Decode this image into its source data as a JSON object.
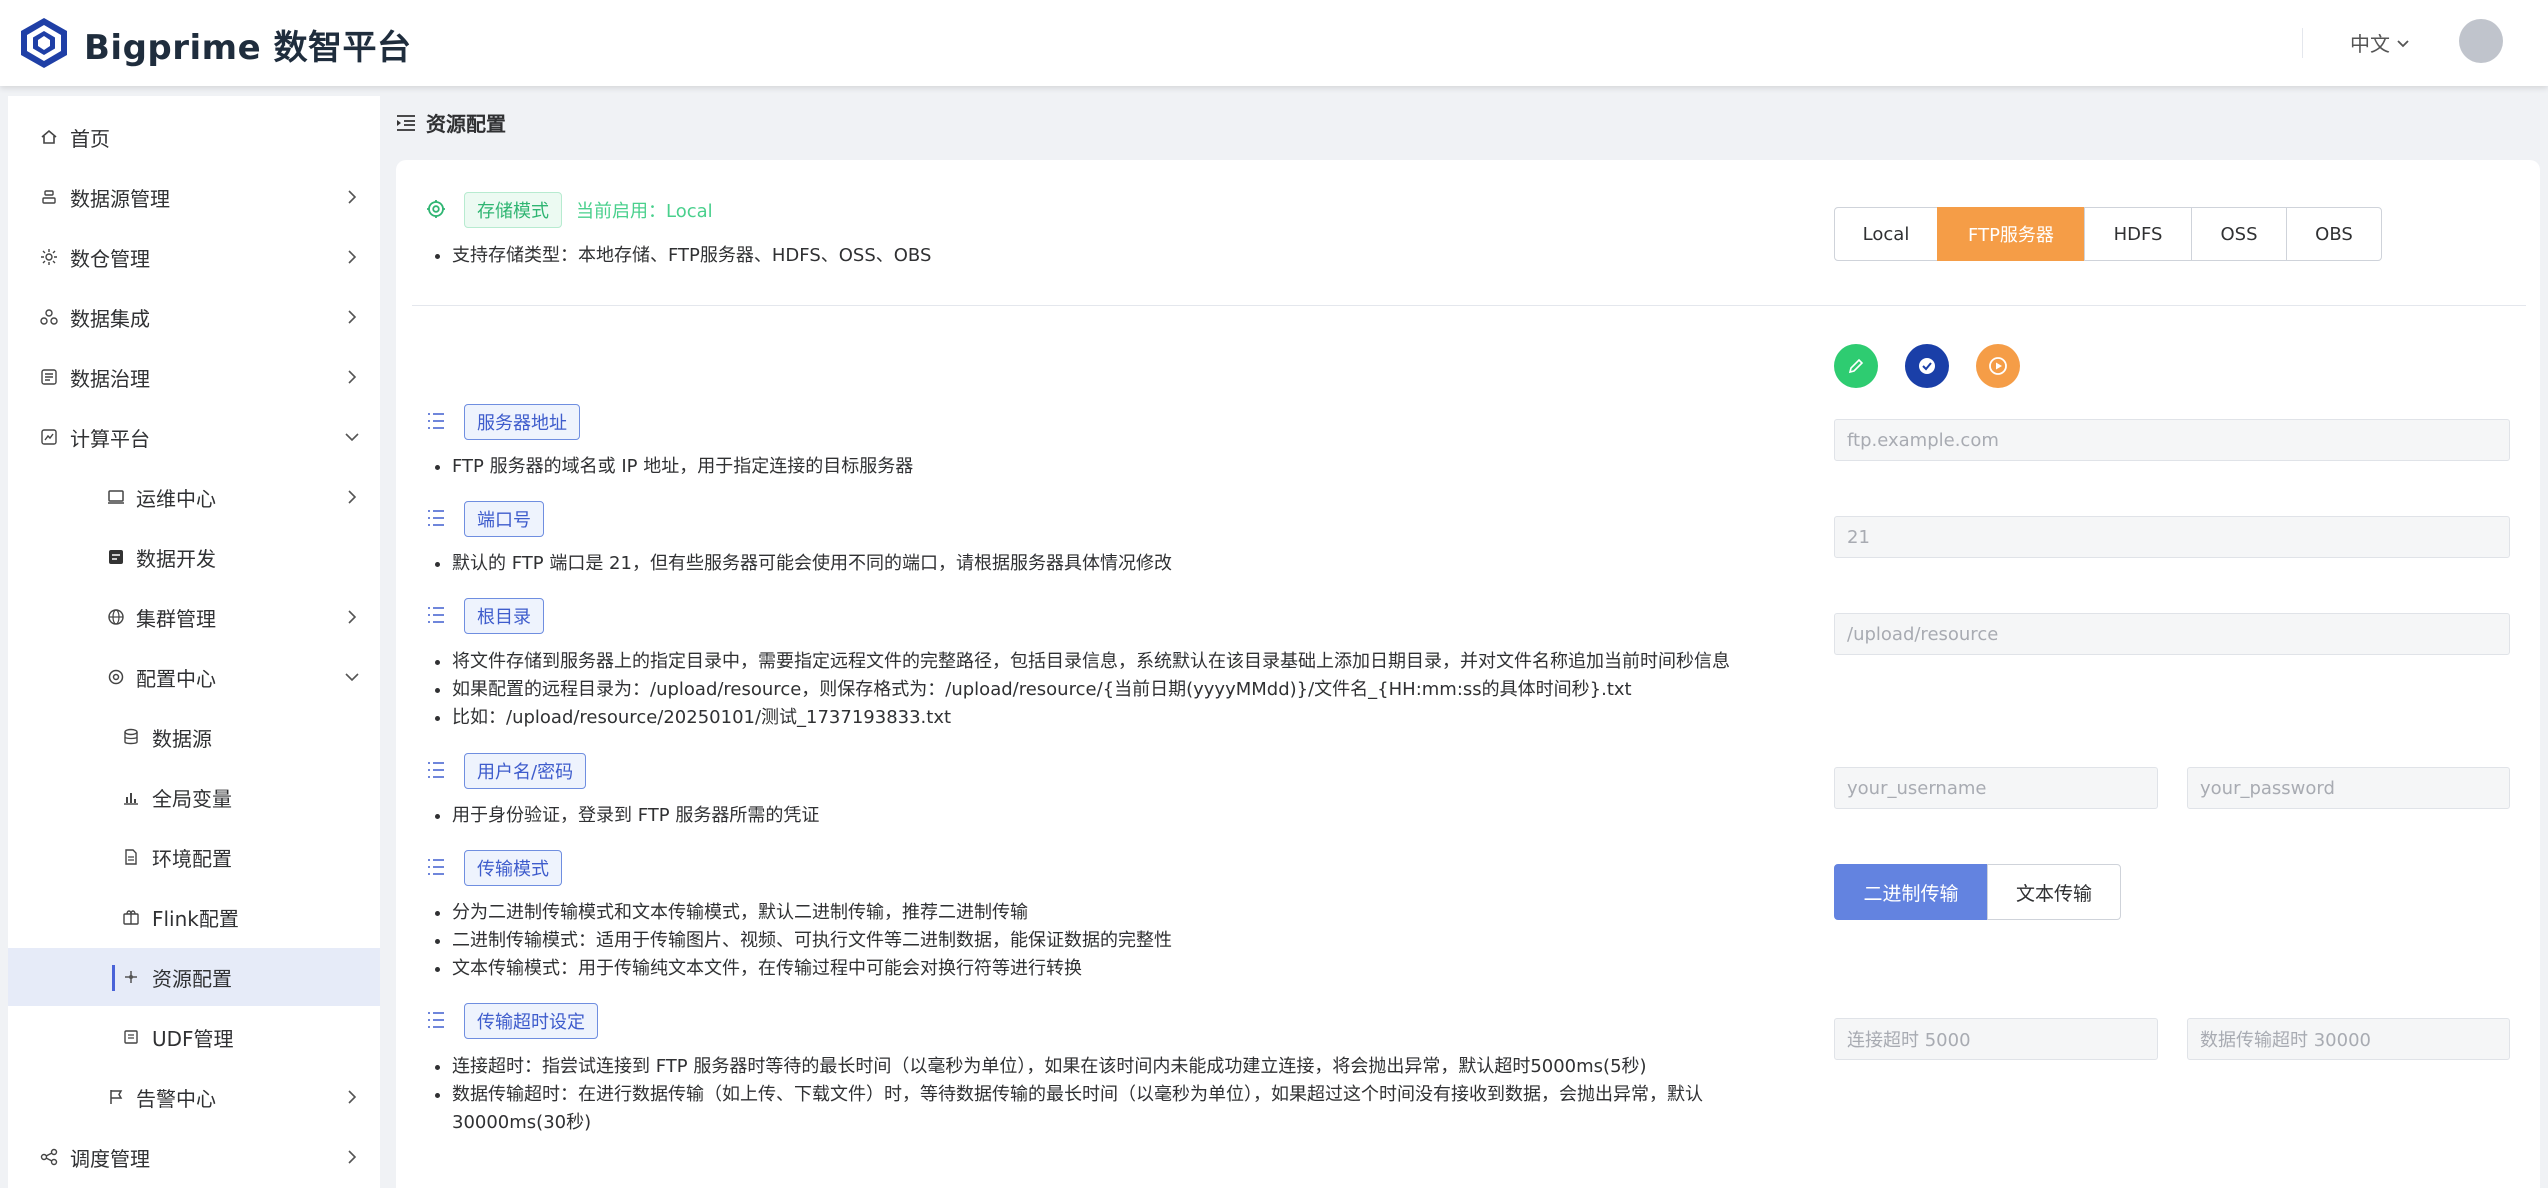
{
  "header": {
    "brand": "Bigprime 数智平台",
    "language": "中文"
  },
  "sidebar": {
    "items": [
      {
        "label": "首页",
        "icon": "home-icon",
        "has_arrow": false
      },
      {
        "label": "数据源管理",
        "icon": "datasource-icon",
        "has_arrow": true
      },
      {
        "label": "数仓管理",
        "icon": "warehouse-icon",
        "has_arrow": true
      },
      {
        "label": "数据集成",
        "icon": "integration-icon",
        "has_arrow": true
      },
      {
        "label": "数据治理",
        "icon": "governance-icon",
        "has_arrow": true
      },
      {
        "label": "计算平台",
        "icon": "compute-icon",
        "has_arrow": true,
        "expanded": true
      },
      {
        "label": "运维中心",
        "icon": "monitor-icon",
        "has_arrow": true
      },
      {
        "label": "数据开发",
        "icon": "dev-icon",
        "has_arrow": false
      },
      {
        "label": "集群管理",
        "icon": "globe-icon",
        "has_arrow": true
      },
      {
        "label": "配置中心",
        "icon": "gear-icon",
        "has_arrow": true,
        "expanded": true
      },
      {
        "label": "数据源",
        "icon": "database-icon",
        "has_arrow": false
      },
      {
        "label": "全局变量",
        "icon": "bar-chart-icon",
        "has_arrow": false
      },
      {
        "label": "环境配置",
        "icon": "file-icon",
        "has_arrow": false
      },
      {
        "label": "Flink配置",
        "icon": "flink-icon",
        "has_arrow": false
      },
      {
        "label": "资源配置",
        "icon": "resource-icon",
        "has_arrow": false,
        "active": true
      },
      {
        "label": "UDF管理",
        "icon": "udf-icon",
        "has_arrow": false
      },
      {
        "label": "告警中心",
        "icon": "flag-icon",
        "has_arrow": true
      },
      {
        "label": "调度管理",
        "icon": "share-icon",
        "has_arrow": true
      }
    ]
  },
  "page": {
    "title": "资源配置"
  },
  "storage": {
    "tag": "存储模式",
    "current": "当前启用：Local",
    "desc": "支持存储类型：本地存储、FTP服务器、HDFS、OSS、OBS",
    "options": [
      "Local",
      "FTP服务器",
      "HDFS",
      "OSS",
      "OBS"
    ],
    "selected": "FTP服务器"
  },
  "sections": {
    "server": {
      "tag": "服务器地址",
      "lines": [
        "FTP 服务器的域名或 IP 地址，用于指定连接的目标服务器"
      ],
      "placeholder": "ftp.example.com"
    },
    "port": {
      "tag": "端口号",
      "lines": [
        "默认的 FTP 端口是 21，但有些服务器可能会使用不同的端口，请根据服务器具体情况修改"
      ],
      "placeholder": "21"
    },
    "root": {
      "tag": "根目录",
      "lines": [
        "将文件存储到服务器上的指定目录中，需要指定远程文件的完整路径，包括目录信息，系统默认在该目录基础上添加日期目录，并对文件名称追加当前时间秒信息",
        "如果配置的远程目录为：/upload/resource，则保存格式为：/upload/resource/{当前日期(yyyyMMdd)}/文件名_{HH:mm:ss的具体时间秒}.txt",
        "比如：/upload/resource/20250101/测试_1737193833.txt"
      ],
      "placeholder": "/upload/resource"
    },
    "auth": {
      "tag": "用户名/密码",
      "lines": [
        "用于身份验证，登录到 FTP 服务器所需的凭证"
      ],
      "username_placeholder": "your_username",
      "password_placeholder": "your_password"
    },
    "mode": {
      "tag": "传输模式",
      "lines": [
        "分为二进制传输模式和文本传输模式，默认二进制传输，推荐二进制传输",
        "二进制传输模式：适用于传输图片、视频、可执行文件等二进制数据，能保证数据的完整性",
        "文本传输模式：用于传输纯文本文件，在传输过程中可能会对换行符等进行转换"
      ],
      "options": [
        "二进制传输",
        "文本传输"
      ],
      "selected": "二进制传输"
    },
    "timeout": {
      "tag": "传输超时设定",
      "lines": [
        "连接超时：指尝试连接到 FTP 服务器时等待的最长时间（以毫秒为单位），如果在该时间内未能成功建立连接，将会抛出异常，默认超时5000ms(5秒)",
        "数据传输超时：在进行数据传输（如上传、下载文件）时，等待数据传输的最长时间（以毫秒为单位），如果超过这个时间没有接收到数据，会抛出异常，默认30000ms(30秒)"
      ],
      "connect_placeholder": "连接超时 5000",
      "data_placeholder": "数据传输超时 30000"
    }
  },
  "colors": {
    "accent": "#4a63d8",
    "storage_selected": "#f59d47",
    "mode_selected": "#6383e0",
    "edit_button": "#2ecc71",
    "check_button": "#1a3fa8",
    "play_button": "#f59d47"
  },
  "actions": {
    "edit": "pencil-icon",
    "confirm": "check-circle-icon",
    "run": "play-icon"
  }
}
